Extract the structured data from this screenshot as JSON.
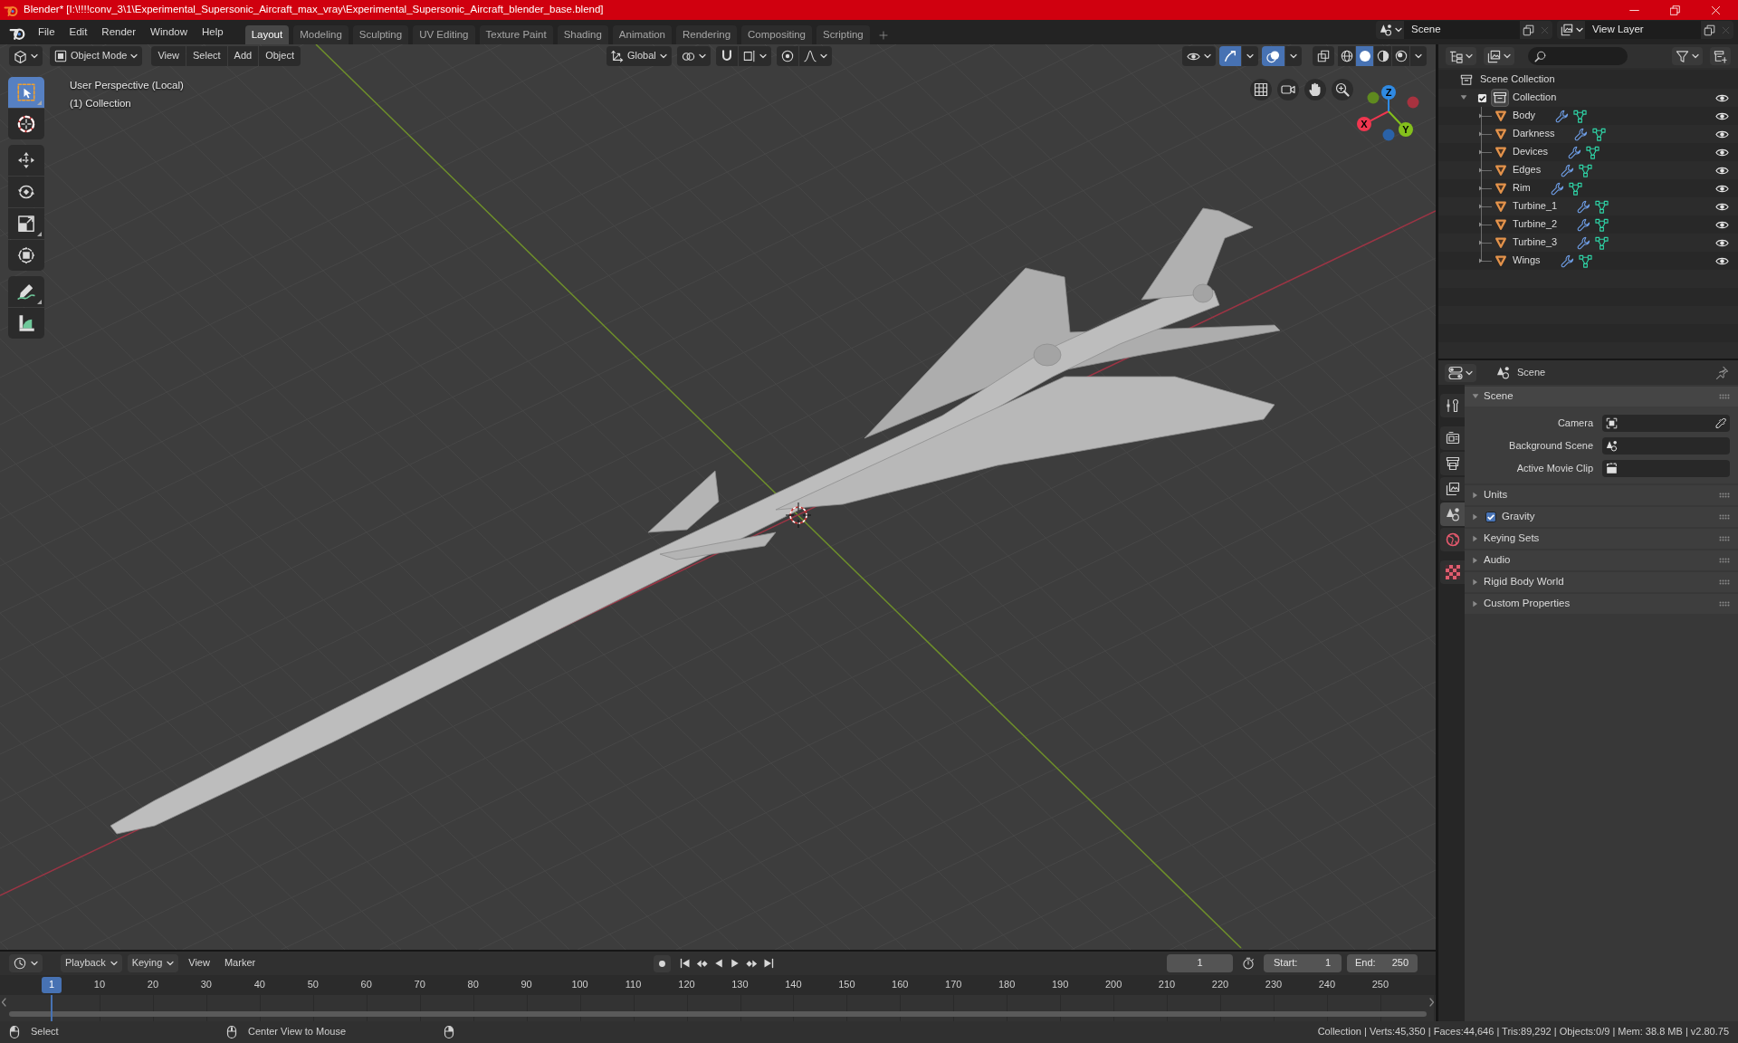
{
  "window": {
    "title": "Blender* [I:\\!!!!conv_3\\1\\Experimental_Supersonic_Aircraft_max_vray\\Experimental_Supersonic_Aircraft_blender_base.blend]"
  },
  "menu_bar": {
    "menus": [
      "File",
      "Edit",
      "Render",
      "Window",
      "Help"
    ]
  },
  "workspace_tabs": [
    {
      "label": "Layout",
      "selected": true
    },
    {
      "label": "Modeling",
      "selected": false
    },
    {
      "label": "Sculpting",
      "selected": false
    },
    {
      "label": "UV Editing",
      "selected": false
    },
    {
      "label": "Texture Paint",
      "selected": false
    },
    {
      "label": "Shading",
      "selected": false
    },
    {
      "label": "Animation",
      "selected": false
    },
    {
      "label": "Rendering",
      "selected": false
    },
    {
      "label": "Compositing",
      "selected": false
    },
    {
      "label": "Scripting",
      "selected": false
    }
  ],
  "scene": {
    "value": "Scene"
  },
  "view_layer": {
    "value": "View Layer"
  },
  "viewport": {
    "mode": "Object Mode",
    "menus": [
      "View",
      "Select",
      "Add",
      "Object"
    ],
    "orientation": "Global",
    "shading": [
      {
        "kind": "wireframe",
        "selected": false
      },
      {
        "kind": "solid",
        "selected": true
      },
      {
        "kind": "material",
        "selected": false
      },
      {
        "kind": "rendered",
        "selected": false
      }
    ],
    "tools": [
      {
        "kind": "select_box",
        "selected": true,
        "has_variants": true
      },
      {
        "kind": "cursor",
        "selected": false,
        "has_variants": false
      },
      {
        "kind": "move",
        "selected": false,
        "has_variants": false
      },
      {
        "kind": "rotate",
        "selected": false,
        "has_variants": false
      },
      {
        "kind": "scale",
        "selected": false,
        "has_variants": true
      },
      {
        "kind": "transform",
        "selected": false,
        "has_variants": false
      },
      {
        "kind": "annotate",
        "selected": false,
        "has_variants": true
      },
      {
        "kind": "measure",
        "selected": false,
        "has_variants": false
      }
    ],
    "info": [
      "User Perspective (Local)",
      "(1) Collection"
    ],
    "gizmo": [
      {
        "kind": "positive",
        "label": "X",
        "color": "#f0364f"
      },
      {
        "kind": "positive",
        "label": "Y",
        "color": "#84c01c"
      },
      {
        "kind": "positive",
        "label": "Z",
        "color": "#2f8ae3"
      },
      {
        "kind": "negative",
        "color": "#a7323f"
      },
      {
        "kind": "negative",
        "color": "#5f8a1f"
      },
      {
        "kind": "negative",
        "color": "#2a62a8"
      }
    ]
  },
  "outliner": {
    "root": "Scene Collection",
    "collections": [
      {
        "label": "Collection",
        "checked": true,
        "expanded": true,
        "visible": true,
        "children": [
          {
            "label": "Body",
            "expanded": false,
            "visible": true
          },
          {
            "label": "Darkness",
            "expanded": false,
            "visible": true
          },
          {
            "label": "Devices",
            "expanded": false,
            "visible": true
          },
          {
            "label": "Edges",
            "expanded": false,
            "visible": true
          },
          {
            "label": "Rim",
            "expanded": false,
            "visible": true
          },
          {
            "label": "Turbine_1",
            "expanded": false,
            "visible": true
          },
          {
            "label": "Turbine_2",
            "expanded": false,
            "visible": true
          },
          {
            "label": "Turbine_3",
            "expanded": false,
            "visible": true
          },
          {
            "label": "Wings",
            "expanded": false,
            "visible": true
          }
        ]
      }
    ]
  },
  "properties": {
    "context": "Scene",
    "tabs": [
      {
        "kind": "tool",
        "selected": false
      },
      {
        "kind": "render",
        "selected": false
      },
      {
        "kind": "output",
        "selected": false
      },
      {
        "kind": "view_layer",
        "selected": false
      },
      {
        "kind": "scene",
        "selected": true
      },
      {
        "kind": "world",
        "selected": false
      },
      {
        "kind": "texture",
        "selected": false
      }
    ],
    "panels": [
      {
        "title": "Scene",
        "expanded": true,
        "fields": [
          {
            "label": "Camera",
            "kind": "camera"
          },
          {
            "label": "Background Scene",
            "kind": "scene"
          },
          {
            "label": "Active Movie Clip",
            "kind": "clip"
          }
        ]
      },
      {
        "title": "Units",
        "expanded": false
      },
      {
        "title": "Gravity",
        "expanded": false,
        "checked": true
      },
      {
        "title": "Keying Sets",
        "expanded": false
      },
      {
        "title": "Audio",
        "expanded": false
      },
      {
        "title": "Rigid Body World",
        "expanded": false
      },
      {
        "title": "Custom Properties",
        "expanded": false
      }
    ]
  },
  "timeline": {
    "menus": [
      {
        "label": "Playback",
        "kind": "dropdown"
      },
      {
        "label": "Keying",
        "kind": "dropdown"
      },
      {
        "label": "View",
        "kind": "menu"
      },
      {
        "label": "Marker",
        "kind": "menu"
      }
    ],
    "current_frame": "1",
    "start": {
      "label": "Start:",
      "value": "1"
    },
    "end": {
      "label": "End:",
      "value": "250"
    },
    "playhead": "1",
    "ticks": [
      "10",
      "20",
      "30",
      "40",
      "50",
      "60",
      "70",
      "80",
      "90",
      "100",
      "110",
      "120",
      "130",
      "140",
      "150",
      "160",
      "170",
      "180",
      "190",
      "200",
      "210",
      "220",
      "230",
      "240",
      "250"
    ]
  },
  "status_bar": {
    "hints": [
      {
        "kind": "left_click",
        "label": "Select"
      },
      {
        "kind": "middle_click",
        "label": "Center View to Mouse"
      },
      {
        "kind": "right_click"
      }
    ],
    "stats": "Collection | Verts:45,350 | Faces:44,646 | Tris:89,292 | Objects:0/9 | Mem: 38.8 MB | v2.80.75"
  }
}
